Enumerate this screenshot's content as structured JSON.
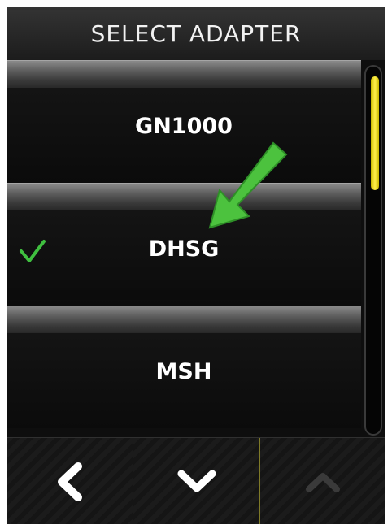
{
  "header": {
    "title": "SELECT ADAPTER"
  },
  "adapters": [
    {
      "label": "GN1000",
      "selected": false
    },
    {
      "label": "DHSG",
      "selected": true
    },
    {
      "label": "MSH",
      "selected": false
    }
  ],
  "scroll": {
    "position_fraction": 0.0
  },
  "icons": {
    "check": "check-icon",
    "pointer": "arrow-down-left-icon",
    "back": "chevron-left-icon",
    "down": "chevron-down-icon",
    "up": "chevron-up-icon"
  },
  "colors": {
    "accent": "#3fbf3f",
    "scroll_thumb": "#f2e020",
    "divider": "#7f7a28"
  }
}
